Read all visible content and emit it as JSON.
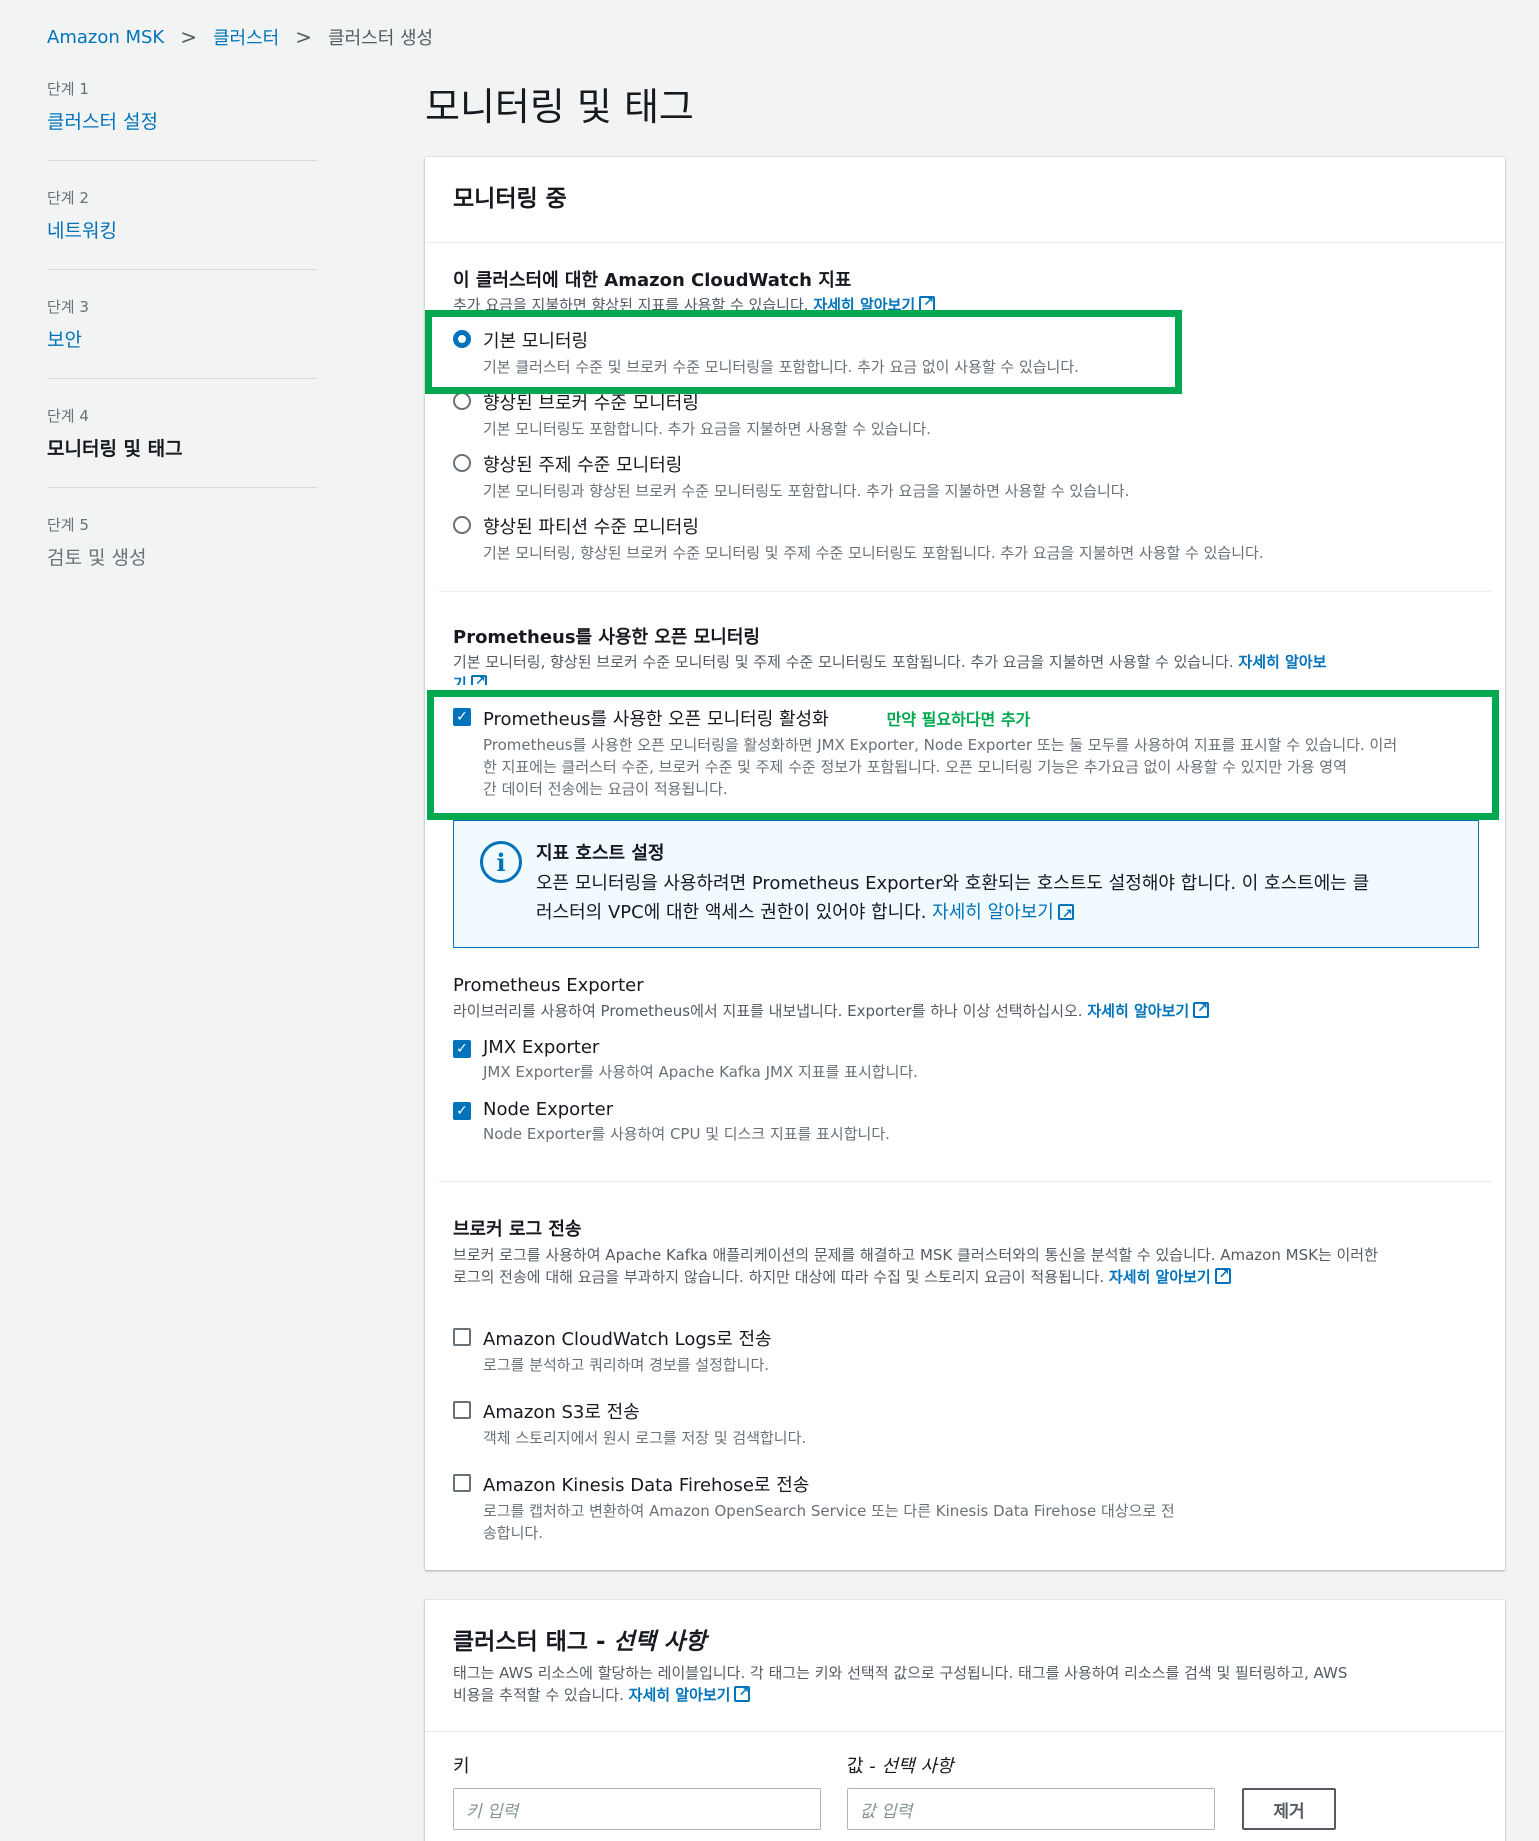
{
  "breadcrumb": {
    "item1": "Amazon MSK",
    "item2": "클러스터",
    "current": "클러스터 생성"
  },
  "steps": [
    {
      "num": "단계 1",
      "label": "클러스터 설정"
    },
    {
      "num": "단계 2",
      "label": "네트워킹"
    },
    {
      "num": "단계 3",
      "label": "보안"
    },
    {
      "num": "단계 4",
      "label": "모니터링 및 태그"
    },
    {
      "num": "단계 5",
      "label": "검토 및 생성"
    }
  ],
  "page_title": "모니터링 및 태그",
  "monitoring": {
    "header": "모니터링 중",
    "cw_label": "이 클러스터에 대한 Amazon CloudWatch 지표",
    "cw_desc": "추가 요금을 지불하면 향상된 지표를 사용할 수 있습니다.",
    "learn_more": "자세히 알아보기",
    "options": [
      {
        "title": "기본 모니터링",
        "desc": "기본 클러스터 수준 및 브로커 수준 모니터링을 포함합니다. 추가 요금 없이 사용할 수 있습니다.",
        "selected": true
      },
      {
        "title": "향상된 브로커 수준 모니터링",
        "desc": "기본 모니터링도 포함합니다. 추가 요금을 지불하면 사용할 수 있습니다.",
        "selected": false
      },
      {
        "title": "향상된 주제 수준 모니터링",
        "desc": "기본 모니터링과 향상된 브로커 수준 모니터링도 포함합니다. 추가 요금을 지불하면 사용할 수 있습니다.",
        "selected": false
      },
      {
        "title": "향상된 파티션 수준 모니터링",
        "desc": "기본 모니터링, 향상된 브로커 수준 모니터링 및 주제 수준 모니터링도 포함됩니다. 추가 요금을 지불하면 사용할 수 있습니다.",
        "selected": false
      }
    ],
    "prom_label": "Prometheus를 사용한 오픈 모니터링",
    "prom_desc": "기본 모니터링, 향상된 브로커 수준 모니터링 및 주제 수준 모니터링도 포함됩니다. 추가 요금을 지불하면 사용할 수 있습니다.",
    "prom_learn_more_1": "자세히 알아보",
    "prom_learn_more_2": "기",
    "prom_enable_title": "Prometheus를 사용한 오픈 모니터링 활성화",
    "prom_enable_note": "만약 필요하다면 추가",
    "prom_enable_desc_1": "Prometheus를 사용한 오픈 모니터링을 활성화하면 JMX Exporter, Node Exporter 또는 둘 모두를 사용하여 지표를 표시할 수 있습니다. 이러",
    "prom_enable_desc_2": "한 지표에는 클러스터 수준, 브로커 수준 및 주제 수준 정보가 포함됩니다. 오픈 모니터링 기능은 추가요금 없이 사용할 수 있지만 가용 영역",
    "prom_enable_desc_3": "간 데이터 전송에는 요금이 적용됩니다.",
    "info_title": "지표 호스트 설정",
    "info_text_1": "오픈 모니터링을 사용하려면 Prometheus Exporter와 호환되는 호스트도 설정해야 합니다. 이 호스트에는 클",
    "info_text_2": "러스터의 VPC에 대한 액세스 권한이 있어야 합니다.",
    "exporter_label": "Prometheus Exporter",
    "exporter_desc": "라이브러리를 사용하여 Prometheus에서 지표를 내보냅니다. Exporter를 하나 이상 선택하십시오.",
    "exporters": [
      {
        "title": "JMX Exporter",
        "desc": "JMX Exporter를 사용하여 Apache Kafka JMX 지표를 표시합니다.",
        "checked": true
      },
      {
        "title": "Node Exporter",
        "desc": "Node Exporter를 사용하여 CPU 및 디스크 지표를 표시합니다.",
        "checked": true
      }
    ],
    "log_label": "브로커 로그 전송",
    "log_desc_1": "브로커 로그를 사용하여 Apache Kafka 애플리케이션의 문제를 해결하고 MSK 클러스터와의 통신을 분석할 수 있습니다. Amazon MSK는 이러한",
    "log_desc_2": "로그의 전송에 대해 요금을 부과하지 않습니다. 하지만 대상에 따라 수집 및 스토리지 요금이 적용됩니다.",
    "log_options": [
      {
        "title": "Amazon CloudWatch Logs로 전송",
        "desc": "로그를 분석하고 쿼리하며 경보를 설정합니다.",
        "checked": false
      },
      {
        "title": "Amazon S3로 전송",
        "desc": "객체 스토리지에서 원시 로그를 저장 및 검색합니다.",
        "checked": false
      },
      {
        "title": "Amazon Kinesis Data Firehose로 전송",
        "desc_1": "로그를 캡처하고 변환하여 Amazon OpenSearch Service 또는 다른 Kinesis Data Firehose 대상으로 전",
        "desc_2": "송합니다.",
        "checked": false
      }
    ]
  },
  "tags": {
    "header_main": "클러스터 태그 - ",
    "header_optional": "선택 사항",
    "desc_1": "태그는 AWS 리소스에 할당하는 레이블입니다. 각 태그는 키와 선택적 값으로 구성됩니다. 태그를 사용하여 리소스를 검색 및 필터링하고, AWS",
    "desc_2": "비용을 추적할 수 있습니다.",
    "learn_more": "자세히 알아보기",
    "key_label": "키",
    "value_label_main": "값 - ",
    "value_label_optional": "선택 사항",
    "key_placeholder": "키 입력",
    "value_placeholder": "값 입력",
    "remove_button": "제거"
  },
  "colors": {
    "accent": "#0073bb",
    "annotation_green": "#00a94f"
  }
}
